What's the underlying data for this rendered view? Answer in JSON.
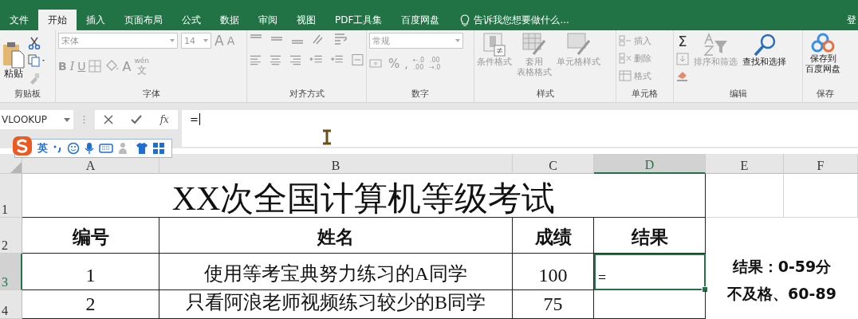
{
  "tabs": [
    {
      "label": "文件",
      "selected": false
    },
    {
      "label": "开始",
      "selected": true
    },
    {
      "label": "插入",
      "selected": false
    },
    {
      "label": "页面布局",
      "selected": false
    },
    {
      "label": "公式",
      "selected": false
    },
    {
      "label": "数据",
      "selected": false
    },
    {
      "label": "审阅",
      "selected": false
    },
    {
      "label": "视图",
      "selected": false
    },
    {
      "label": "PDF工具集",
      "selected": false
    },
    {
      "label": "百度网盘",
      "selected": false
    }
  ],
  "tell_me": "告诉我您想要做什么...",
  "sign_in": "登",
  "ribbon": {
    "clipboard": {
      "paste": "粘贴",
      "label": "剪贴板"
    },
    "font": {
      "family": "宋体",
      "size": "14",
      "grow": "A",
      "shrink": "A",
      "bold": "B",
      "italic": "I",
      "underline": "U",
      "font_color": "A",
      "phonetic_top": "wén",
      "phonetic_bottom": "文",
      "label": "字体"
    },
    "alignment": {
      "label": "对齐方式"
    },
    "number": {
      "format": "常规",
      "percent": "%",
      "comma": ",",
      "decimal_up": [
        "←.0",
        ".00"
      ],
      "decimal_down": [
        ".00",
        "→.0"
      ],
      "label": "数字"
    },
    "styles": {
      "conditional": "条件格式",
      "table_format": [
        "套用",
        "表格格式"
      ],
      "cell_styles": "单元格样式",
      "label": "样式"
    },
    "cells": {
      "insert": "插入",
      "delete": "删除",
      "format": "格式",
      "label": "单元格"
    },
    "editing": {
      "sum": "Σ",
      "sort_filter": "排序和筛选",
      "find_select": "查找和选择",
      "label": "编辑"
    },
    "save": {
      "save_to": [
        "保存到",
        "百度网盘"
      ],
      "label": "保存"
    }
  },
  "formula_bar": {
    "name_box": "VLOOKUP",
    "function_label": "fx",
    "formula": "="
  },
  "ime": {
    "mode": "英"
  },
  "sheet": {
    "columns": [
      {
        "label": "A",
        "selected": false
      },
      {
        "label": "B",
        "selected": false
      },
      {
        "label": "C",
        "selected": false
      },
      {
        "label": "D",
        "selected": true
      },
      {
        "label": "E",
        "selected": false
      },
      {
        "label": "F",
        "selected": false
      }
    ],
    "rows": [
      {
        "label": "1",
        "selected": false
      },
      {
        "label": "2",
        "selected": false
      },
      {
        "label": "3",
        "selected": true
      },
      {
        "label": "4",
        "selected": false
      }
    ],
    "title": "XX次全国计算机等级考试",
    "header": [
      "编号",
      "姓名",
      "成绩",
      "结果"
    ],
    "records": [
      {
        "id": "1",
        "name": "使用等考宝典努力练习的A同学",
        "score": "100",
        "result": "=",
        "active": true
      },
      {
        "id": "2",
        "name": "只看阿浪老师视频练习较少的B同学",
        "score": "75",
        "active": false
      }
    ],
    "note": [
      "结果：0-59分",
      "不及格、60-89"
    ]
  }
}
